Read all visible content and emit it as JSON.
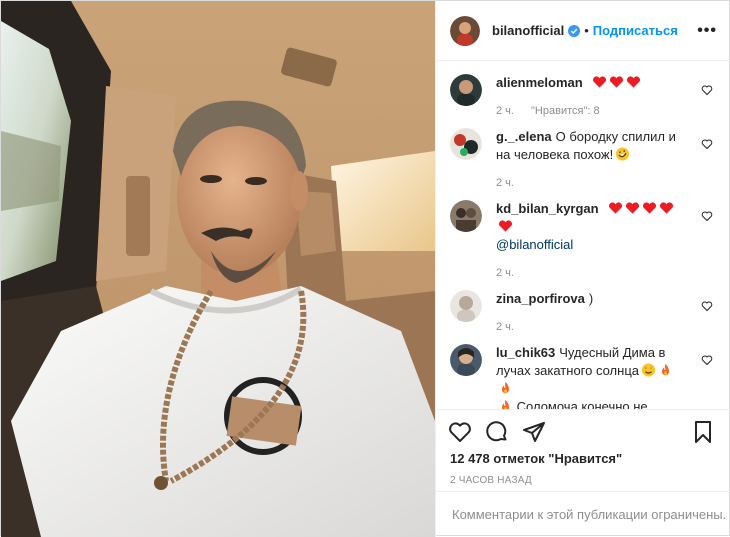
{
  "header": {
    "username": "bilanofficial",
    "separator": "•",
    "follow_label": "Подписаться",
    "more_label": "•••"
  },
  "comments": [
    {
      "user": "alienmeloman",
      "text": "",
      "emoji": [
        "heart",
        "heart",
        "heart"
      ],
      "time": "2 ч.",
      "likes": "\"Нравится\": 8"
    },
    {
      "user": "g._.elena",
      "text": "О бородку спилил и на человека похож!",
      "emoji": [
        "rofl"
      ],
      "time": "2 ч.",
      "likes": ""
    },
    {
      "user": "kd_bilan_kyrgan",
      "text": "",
      "emoji": [
        "heart",
        "heart",
        "heart",
        "heart",
        "heart"
      ],
      "mention": "@bilanofficial",
      "time": "2 ч.",
      "likes": ""
    },
    {
      "user": "zina_porfirova",
      "text": ")",
      "emoji": [],
      "time": "2 ч.",
      "likes": ""
    },
    {
      "user": "lu_chik63",
      "text": "Чудесный Дима в лучах закатного солнца",
      "emoji": [
        "star-eyes",
        "fire",
        "fire"
      ],
      "text2": "Соломоча конечно не узнать",
      "time": "",
      "likes": ""
    }
  ],
  "likes_count": "12 478 отметок \"Нравится\"",
  "timestamp": "2 ЧАСОВ НАЗАД",
  "comments_limited": "Комментарии к этой публикации ограничены.",
  "icons": {
    "like": "heart-outline-icon",
    "comment": "comment-bubble-icon",
    "share": "paper-plane-icon",
    "save": "bookmark-icon"
  },
  "colors": {
    "accent": "#0095f6",
    "verified": "#3897f0",
    "heart": "#ed1c24",
    "muted": "#8e8e8e"
  }
}
